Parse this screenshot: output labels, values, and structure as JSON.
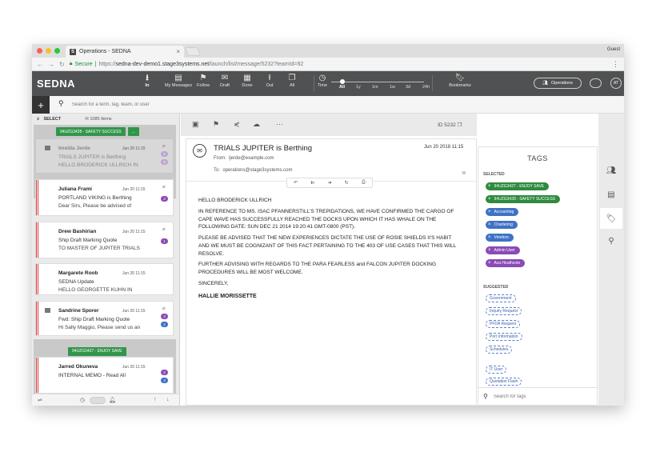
{
  "browser": {
    "tab_title": "Operations - SEDNA",
    "tab_favicon": "S",
    "profile": "Guest",
    "secure_label": "Secure",
    "url_scheme": "https://",
    "url_host": "sedna-dev-demo1.stage3systems.net",
    "url_path": "/launch/list/message/5232?teamId=92"
  },
  "app": {
    "logo": "SEDNA",
    "toolbar": [
      {
        "label": "In",
        "icon": "download-icon",
        "glyph": "⭳",
        "active": true
      },
      {
        "label": "My Messages",
        "icon": "inbox-icon",
        "glyph": "▤",
        "active": false
      },
      {
        "label": "Follow",
        "icon": "flag-icon",
        "glyph": "⚑",
        "active": false
      },
      {
        "label": "Draft",
        "icon": "envelope-open-icon",
        "glyph": "✉",
        "active": false
      },
      {
        "label": "Done",
        "icon": "archive-icon",
        "glyph": "▦",
        "active": false
      },
      {
        "label": "Out",
        "icon": "upload-icon",
        "glyph": "⭱",
        "active": false
      },
      {
        "label": "All",
        "icon": "copy-icon",
        "glyph": "❐",
        "active": false
      }
    ],
    "time": {
      "label": "Time",
      "icon": "clock-icon",
      "ranges": [
        "All",
        "1y",
        "1m",
        "1w",
        "3d",
        "24h"
      ],
      "selected": "All"
    },
    "bookmarks_label": "Bookmarks",
    "operations_label": "Operations",
    "avatar_initials": "AT"
  },
  "search": {
    "placeholder": "Search for a term, tag, team, or user"
  },
  "list": {
    "select_label": "SELECT",
    "count_label": "1085 Items",
    "group1_tag": "94UZG3428 - SAFETY SUCCESS",
    "group1_more": "...",
    "group2_tag": "94UZG3427 - ENJOY SAVE",
    "messages": [
      {
        "name": "Imelda Jerde",
        "date": "Jun 20 11:15",
        "subject": "TRIALS JUPITER is Berthing",
        "preview": "HELLO BRODERICK ULLRICH IN",
        "badges": [
          "2",
          "3"
        ]
      },
      {
        "name": "Juliana Frami",
        "date": "Jun 20 11:15",
        "subject": "PORTLAND VIKING is Berthing",
        "preview": "Dear Sirs, Please be advised of",
        "badges": [
          "2"
        ]
      },
      {
        "name": "Drew Bashirian",
        "date": "Jun 20 11:15",
        "subject": "Ship Draft Marking Quote",
        "preview": "TO MASTER OF JUPITER TRIALS",
        "badges": [
          "1"
        ]
      },
      {
        "name": "Margarete Roob",
        "date": "Jun 20 11:15",
        "subject": "SEDNA Update",
        "preview": "HELLO GEORGETTE KUHN IN",
        "badges": []
      },
      {
        "name": "Sandrine Sporer",
        "date": "Jun 20 11:15",
        "subject": "Fwd: Ship Draft Marking Quote",
        "preview": "Hi Sally Maggio, Please send us an",
        "badges": [
          "3",
          "2"
        ]
      },
      {
        "name": "Jarred Okuneva",
        "date": "Jun 20 11:15",
        "subject": "INTERNAL MEMO - Read All",
        "preview": "",
        "badges": [
          "2",
          "3"
        ]
      }
    ]
  },
  "reader": {
    "id_label": "ID 5232",
    "subject": "TRIALS JUPITER is Berthing",
    "date": "Jun 20 2018 11:15",
    "from_label": "From:",
    "from_value": "ijerde@example.com",
    "to_label": "To:",
    "to_value": "operations@stage3systems.com",
    "body": [
      "HELLO BRODERICK ULLRICH",
      "IN REFERENCE TO MS. ISAC PFANNERSTILL'S TREPIDATIONS, WE HAVE CONFIRMED THE CARGO OF CAPE WAVE HAS SUCCESSFULLY REACHED THE DOCKS UPON WHICH IT HAS WHALE ON THE FOLLOWING DATE: SUN DEC 21 2014 19:20:41 GMT-0800 (PST).",
      "PLEASE BE ADVISED THAT THE NEW EXPERIENCES DICTATE THE USE OF ROSIE SHIELDS II'S HABIT AND WE MUST BE COGNIZANT OF THIS FACT PERTAINING TO THE 403 OF USE CASES THAT THIS WILL RESOLVE.",
      "FURTHER ADVISING WITH REGARDS TO THE PARA FEARLESS and FALCON JUPITER DOCKING PROCEDURES WILL BE MOST WELCOME.",
      "SINCERELY,"
    ],
    "signature": "HALLIE MORISSETTE"
  },
  "tags": {
    "title": "TAGS",
    "selected_label": "SELECTED",
    "selected": [
      {
        "label": "94UZG3427 - ENJOY SAVE",
        "color": "#2e8b3e"
      },
      {
        "label": "94UZG3428 - SAFETY SUCCESS",
        "color": "#2e8b3e"
      },
      {
        "label": "Accounting",
        "color": "#3f72c4"
      },
      {
        "label": "Chartering",
        "color": "#3f72c4"
      },
      {
        "label": "Vendors",
        "color": "#3f72c4"
      },
      {
        "label": "Admin User",
        "color": "#8a4bb5"
      },
      {
        "label": "Ava Heathcote",
        "color": "#8a4bb5"
      }
    ],
    "suggested_label": "SUGGESTED",
    "suggested": [
      "Government",
      "Inquiry Request",
      "PFDA Request",
      "Port Information",
      "Schedules",
      "IT User",
      "Quotation Flash"
    ],
    "search_placeholder": "Search for tags"
  },
  "colors": {
    "header": "#4f5152",
    "group_tag": "#32964a",
    "badge_purple": "#8a4bb5",
    "badge_blue": "#3f72c4",
    "red_bar": "#d43b3b"
  }
}
